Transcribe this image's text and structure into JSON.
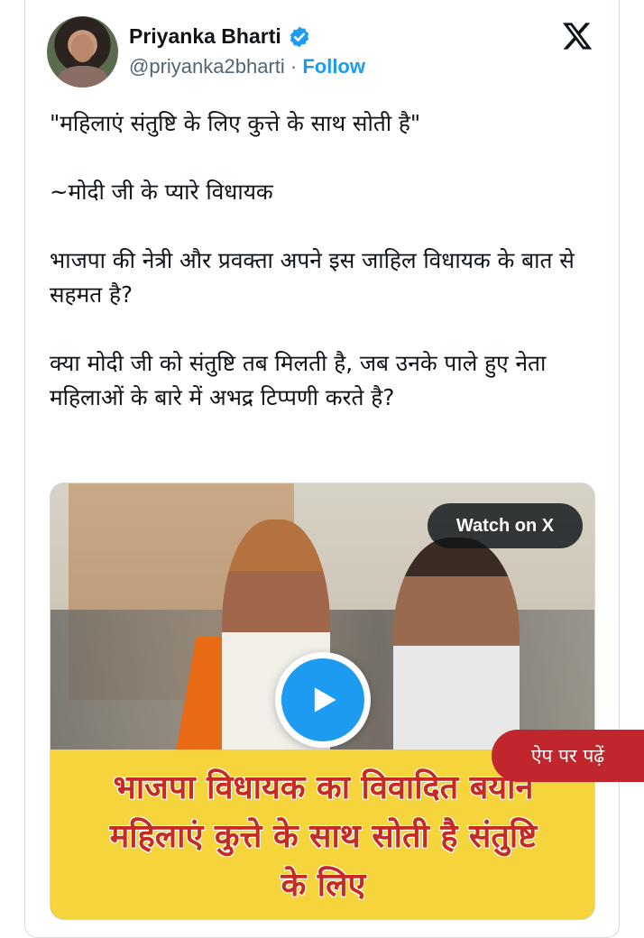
{
  "author": {
    "name": "Priyanka Bharti",
    "handle": "@priyanka2bharti",
    "separator": " · ",
    "follow_label": "Follow"
  },
  "tweet": {
    "lines": [
      "\"महिलाएं संतुष्टि के लिए कुत्ते के साथ सोती है\"",
      "~मोदी जी के प्यारे विधायक",
      "भाजपा की नेत्री और प्रवक्ता अपने इस जाहिल विधायक के बात से सहमत है?",
      "क्या मोदी जी को संतुष्टि तब मिलती है, जब उनके पाले हुए नेता महिलाओं के बारे में अभद्र टिप्पणी करते है?"
    ]
  },
  "media": {
    "watch_label": "Watch on X",
    "banner_lines": [
      "भाजपा विधायक का विवादित बयान",
      "महिलाएं कुत्ते के साथ सोती है संतुष्टि",
      "के लिए"
    ]
  },
  "app_pill": "ऐप पर पढ़ें",
  "colors": {
    "accent": "#1d9bf0",
    "text": "#0f1419",
    "muted": "#536471",
    "banner": "#f5d43c",
    "banner_text": "#c62a22",
    "pill": "#c0262b"
  },
  "icons": [
    "verified-badge-icon",
    "x-logo-icon",
    "play-icon"
  ]
}
